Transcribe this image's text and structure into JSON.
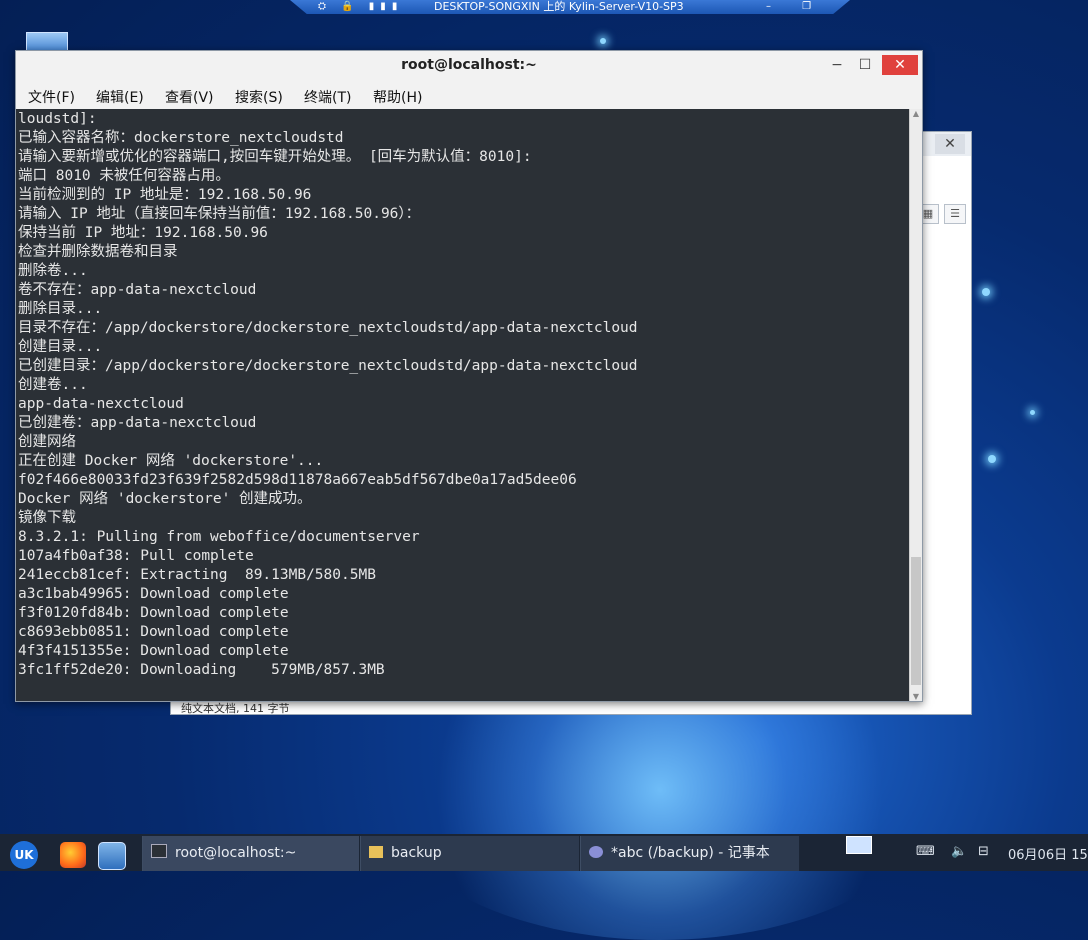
{
  "rdp": {
    "icons": "⛭ 🔒 ▮▮▮",
    "title": "DESKTOP-SONGXIN 上的 Kylin-Server-V10-SP3",
    "controls": "–  ❐  ✕"
  },
  "terminal": {
    "title": "root@localhost:~",
    "controls": {
      "minimize": "−",
      "maximize": "☐",
      "close": "✕"
    },
    "menu": [
      "文件(F)",
      "编辑(E)",
      "查看(V)",
      "搜索(S)",
      "终端(T)",
      "帮助(H)"
    ],
    "lines": [
      "loudstd]:",
      "已输入容器名称：dockerstore_nextcloudstd",
      "请输入要新增或优化的容器端口,按回车键开始处理。 [回车为默认值：8010]:",
      "端口 8010 未被任何容器占用。",
      "当前检测到的 IP 地址是：192.168.50.96",
      "请输入 IP 地址（直接回车保持当前值：192.168.50.96）：",
      "保持当前 IP 地址：192.168.50.96",
      "检查并删除数据卷和目录",
      "删除卷...",
      "卷不存在：app-data-nexctcloud",
      "删除目录...",
      "目录不存在：/app/dockerstore/dockerstore_nextcloudstd/app-data-nexctcloud",
      "创建目录...",
      "已创建目录：/app/dockerstore/dockerstore_nextcloudstd/app-data-nexctcloud",
      "创建卷...",
      "app-data-nexctcloud",
      "已创建卷：app-data-nexctcloud",
      "创建网络",
      "正在创建 Docker 网络 'dockerstore'...",
      "f02f466e80033fd23f639f2582d598d11878a667eab5df567dbe0a17ad5dee06",
      "Docker 网络 'dockerstore' 创建成功。",
      "镜像下载",
      "8.3.2.1: Pulling from weboffice/documentserver",
      "107a4fb0af38: Pull complete",
      "241eccb81cef: Extracting  89.13MB/580.5MB",
      "a3c1bab49965: Download complete",
      "f3f0120fd84b: Download complete",
      "c8693ebb0851: Download complete",
      "4f3f4151355e: Download complete",
      "3fc1ff52de20: Downloading    579MB/857.3MB"
    ]
  },
  "notepad_bg": {
    "close": "✕",
    "status": "纯文本文档, 141 字节"
  },
  "taskbar": {
    "start": "UK",
    "tasks": [
      {
        "label": "root@localhost:~"
      },
      {
        "label": "backup"
      },
      {
        "label": "*abc (/backup) - 记事本"
      }
    ],
    "clock": "06月06日 15"
  }
}
